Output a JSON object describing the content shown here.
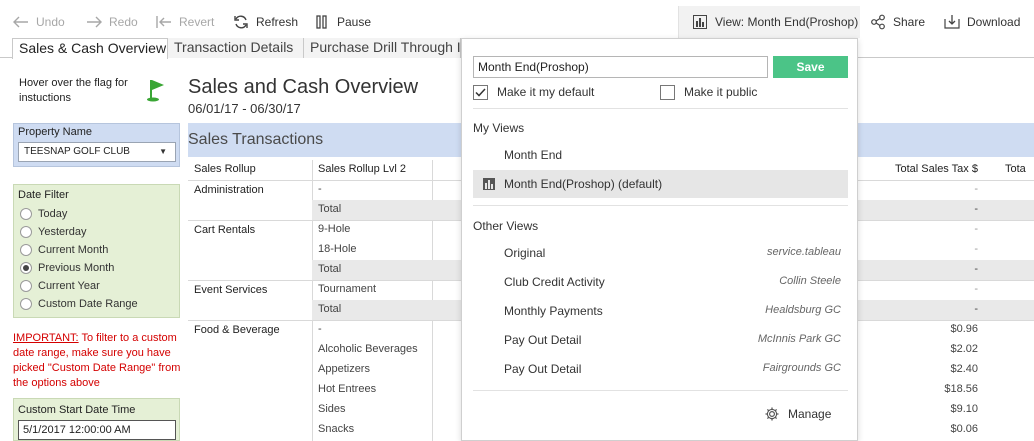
{
  "toolbar": {
    "undo": "Undo",
    "redo": "Redo",
    "revert": "Revert",
    "refresh": "Refresh",
    "pause": "Pause",
    "view": "View: Month End(Proshop)",
    "share": "Share",
    "download": "Download"
  },
  "tabs": [
    {
      "label": "Sales & Cash Overview"
    },
    {
      "label": "Transaction Details"
    },
    {
      "label": "Purchase Drill Through I"
    }
  ],
  "left": {
    "hover_note": "Hover over the flag for instuctions",
    "property_title": "Property Name",
    "property_value": "TEESNAP GOLF CLUB",
    "date_filter_title": "Date Filter",
    "date_options": [
      "Today",
      "Yesterday",
      "Current Month",
      "Previous Month",
      "Current Year",
      "Custom Date Range"
    ],
    "date_selected": "Previous Month",
    "important_prefix": "IMPORTANT:",
    "important_text": " To filter to a custom date range, make sure you have picked \"Custom Date Range\" from the options above",
    "start_title": "Custom Start Date Time",
    "start_value": "5/1/2017 12:00:00 AM"
  },
  "main": {
    "title": "Sales and Cash Overview",
    "subtitle": "06/01/17 - 06/30/17",
    "section": "Sales Transactions",
    "columns": {
      "rollup": "Sales Rollup",
      "rollup2": "Sales Rollup Lvl 2",
      "tax": "Total Sales Tax $",
      "total": "Tota"
    },
    "groups": [
      "Administration",
      "Cart Rentals",
      "Event Services",
      "Food & Beverage"
    ],
    "rows": [
      {
        "label": "-",
        "value": "-"
      },
      {
        "label": "Total",
        "value": "-"
      },
      {
        "label": "9-Hole",
        "value": "-"
      },
      {
        "label": "18-Hole",
        "value": "-"
      },
      {
        "label": "Total",
        "value": "-"
      },
      {
        "label": "Tournament",
        "value": "-"
      },
      {
        "label": "Total",
        "value": "-"
      },
      {
        "label": "-",
        "value": "$0.96"
      },
      {
        "label": "Alcoholic Beverages",
        "value": "$2.02"
      },
      {
        "label": "Appetizers",
        "value": "$2.40"
      },
      {
        "label": "Hot Entrees",
        "value": "$18.56"
      },
      {
        "label": "Sides",
        "value": "$9.10"
      },
      {
        "label": "Snacks",
        "value": "$0.06"
      }
    ]
  },
  "dropdown": {
    "name_value": "Month End(Proshop)",
    "save": "Save",
    "make_default": "Make it my default",
    "make_public": "Make it public",
    "my_views_title": "My Views",
    "my_views": [
      {
        "name": "Month End"
      },
      {
        "name": "Month End(Proshop) (default)"
      }
    ],
    "other_views_title": "Other Views",
    "other_views": [
      {
        "name": "Original",
        "owner": "service.tableau"
      },
      {
        "name": "Club Credit Activity",
        "owner": "Collin Steele"
      },
      {
        "name": "Monthly Payments",
        "owner": "Healdsburg GC"
      },
      {
        "name": "Pay Out Detail",
        "owner": "McInnis Park GC"
      },
      {
        "name": "Pay Out Detail",
        "owner": "Fairgrounds GC"
      }
    ],
    "manage": "Manage"
  },
  "colors": {
    "accent_green": "#4bc487",
    "filter_blue": "#cfdcf2",
    "filter_green": "#e5f0d6",
    "important_red": "#d40000",
    "flag_green": "#3aa635"
  }
}
